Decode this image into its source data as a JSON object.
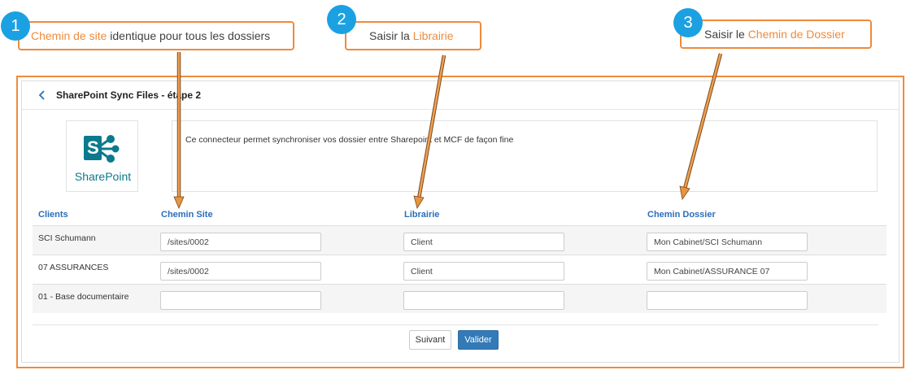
{
  "callouts": [
    {
      "number": "1",
      "highlight": "Chemin de site",
      "text": " identique pour tous les dossiers",
      "order": "highlight-first"
    },
    {
      "number": "2",
      "prefix": "Saisir la ",
      "highlight": "Librairie",
      "order": "prefix-first"
    },
    {
      "number": "3",
      "prefix": "Saisir le ",
      "highlight": "Chemin de Dossier",
      "order": "prefix-first"
    }
  ],
  "header": {
    "title": "SharePoint Sync Files - étape 2"
  },
  "logo": {
    "letter": "S",
    "text": "SharePoint"
  },
  "description": "Ce connecteur permet synchroniser vos dossier entre Sharepoint et MCF de façon fine",
  "columns": {
    "clients": "Clients",
    "site": "Chemin Site",
    "library": "Librairie",
    "folder": "Chemin Dossier"
  },
  "rows": [
    {
      "client": "SCI Schumann",
      "site": "/sites/0002",
      "library": "Client",
      "folder": "Mon Cabinet/SCI Schumann"
    },
    {
      "client": "07 ASSURANCES",
      "site": "/sites/0002",
      "library": "Client",
      "folder": "Mon Cabinet/ASSURANCE 07"
    },
    {
      "client": "01 - Base documentaire",
      "site": "",
      "library": "",
      "folder": ""
    }
  ],
  "buttons": {
    "secondary": "Suivant",
    "primary": "Valider"
  },
  "colors": {
    "accent_orange": "#ED8B3E",
    "badge_blue": "#1BA1E2",
    "header_blue": "#2A6EBB",
    "primary_button": "#337AB7",
    "sharepoint_teal": "#0B7A8C"
  }
}
